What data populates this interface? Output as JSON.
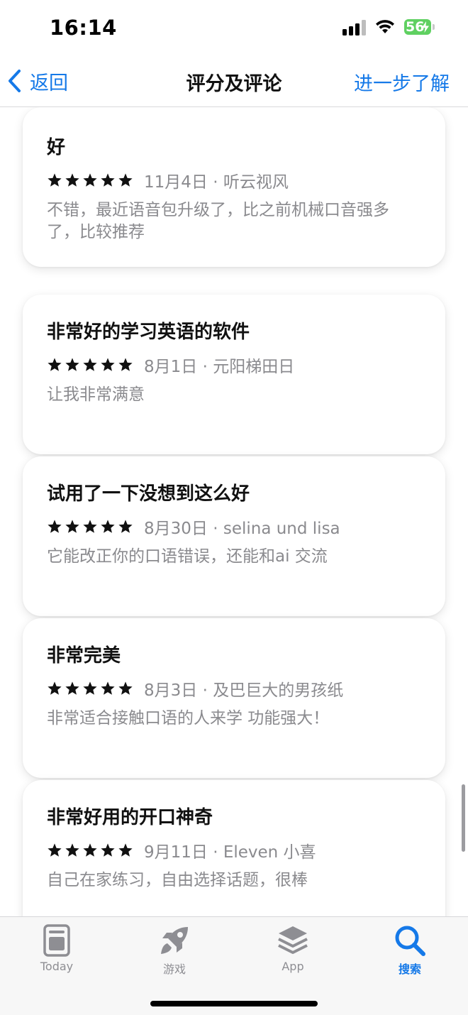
{
  "status_bar": {
    "time": "16:14",
    "battery": "56"
  },
  "nav": {
    "back_label": "返回",
    "title": "评分及评论",
    "more_label": "进一步了解"
  },
  "reviews": [
    {
      "title": "好",
      "meta": "11月4日 · 听云视风",
      "body": "不错，最近语音包升级了，比之前机械口音强多了，比较推荐",
      "rating": 5
    },
    {
      "title": "非常好的学习英语的软件",
      "meta": "8月1日 · 元阳梯田日",
      "body": "让我非常满意",
      "rating": 5
    },
    {
      "title": "试用了一下没想到这么好",
      "meta": "8月30日 · selina und lisa",
      "body": "它能改正你的口语错误，还能和ai 交流",
      "rating": 5
    },
    {
      "title": "非常完美",
      "meta": "8月3日 · 及巴巨大的男孩纸",
      "body": "非常适合接触口语的人来学 功能强大！",
      "rating": 5
    },
    {
      "title": "非常好用的开口神奇",
      "meta": "9月11日 · Eleven 小喜",
      "body": "自己在家练习，自由选择话题，很棒",
      "rating": 5
    }
  ],
  "tabs": [
    {
      "label": "Today",
      "icon": "today-icon",
      "active": false
    },
    {
      "label": "游戏",
      "icon": "rocket-icon",
      "active": false
    },
    {
      "label": "App",
      "icon": "app-stack-icon",
      "active": false
    },
    {
      "label": "搜索",
      "icon": "search-icon",
      "active": true
    }
  ],
  "colors": {
    "accent": "#1579e8",
    "battery": "#5fd061",
    "secondary_text": "#8a8a8e"
  }
}
